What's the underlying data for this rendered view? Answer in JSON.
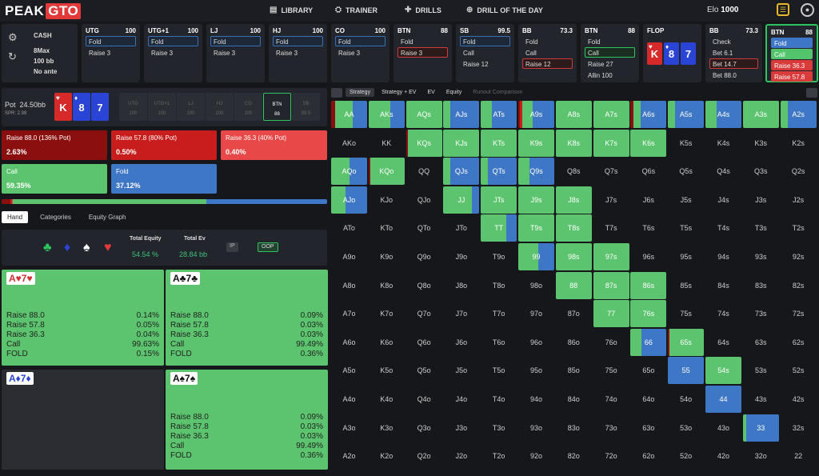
{
  "app": {
    "logo_a": "PEAK",
    "logo_b": "GTO"
  },
  "nav": [
    {
      "icon": "▤",
      "label": "LIBRARY"
    },
    {
      "icon": "⛭",
      "label": "TRAINER"
    },
    {
      "icon": "✚",
      "label": "DRILLS"
    },
    {
      "icon": "⊕",
      "label": "DRILL OF THE DAY"
    }
  ],
  "elo": {
    "label": "Elo",
    "value": "1000"
  },
  "game": {
    "type": "CASH",
    "size": "8Max",
    "stack": "100 bb",
    "ante": "No ante"
  },
  "seats": [
    {
      "pos": "UTG",
      "stack": "100",
      "actions": [
        {
          "l": "Fold",
          "s": "sel"
        },
        {
          "l": "Raise 3",
          "s": ""
        }
      ]
    },
    {
      "pos": "UTG+1",
      "stack": "100",
      "actions": [
        {
          "l": "Fold",
          "s": "sel"
        },
        {
          "l": "Raise 3",
          "s": ""
        }
      ]
    },
    {
      "pos": "LJ",
      "stack": "100",
      "actions": [
        {
          "l": "Fold",
          "s": "sel"
        },
        {
          "l": "Raise 3",
          "s": ""
        }
      ]
    },
    {
      "pos": "HJ",
      "stack": "100",
      "actions": [
        {
          "l": "Fold",
          "s": "sel"
        },
        {
          "l": "Raise 3",
          "s": ""
        }
      ]
    },
    {
      "pos": "CO",
      "stack": "100",
      "actions": [
        {
          "l": "Fold",
          "s": "sel"
        },
        {
          "l": "Raise 3",
          "s": ""
        }
      ]
    },
    {
      "pos": "BTN",
      "stack": "88",
      "actions": [
        {
          "l": "Fold",
          "s": ""
        },
        {
          "l": "Raise 3",
          "s": "selr"
        }
      ]
    },
    {
      "pos": "SB",
      "stack": "99.5",
      "actions": [
        {
          "l": "Fold",
          "s": "sel"
        },
        {
          "l": "Call",
          "s": ""
        },
        {
          "l": "Raise 12",
          "s": ""
        }
      ]
    },
    {
      "pos": "BB",
      "stack": "73.3",
      "actions": [
        {
          "l": "Fold",
          "s": ""
        },
        {
          "l": "Call",
          "s": ""
        },
        {
          "l": "Raise 12",
          "s": "selr"
        }
      ]
    },
    {
      "pos": "BTN",
      "stack": "88",
      "actions": [
        {
          "l": "Fold",
          "s": ""
        },
        {
          "l": "Call",
          "s": "selg"
        },
        {
          "l": "Raise 27",
          "s": ""
        },
        {
          "l": "Allin 100",
          "s": ""
        }
      ]
    },
    {
      "pos": "FLOP",
      "stack": "",
      "actions": []
    },
    {
      "pos": "BB",
      "stack": "73.3",
      "actions": [
        {
          "l": "Check",
          "s": ""
        },
        {
          "l": "Bet 6.1",
          "s": ""
        },
        {
          "l": "Bet 14.7",
          "s": "selr"
        },
        {
          "l": "Bet 88.0",
          "s": ""
        }
      ]
    },
    {
      "pos": "BTN",
      "stack": "88",
      "actions": [
        {
          "l": "Fold",
          "s": "fg"
        },
        {
          "l": "Call",
          "s": "fgg"
        },
        {
          "l": "Raise 36.3",
          "s": "fgr"
        },
        {
          "l": "Raise 57.8",
          "s": "fgr"
        }
      ]
    }
  ],
  "flop": [
    {
      "rank": "K",
      "suit": "♥",
      "color": "red"
    },
    {
      "rank": "8",
      "suit": "♦",
      "color": "blue"
    },
    {
      "rank": "7",
      "suit": "",
      "color": "blue"
    }
  ],
  "pot": {
    "label": "Pot",
    "value": "24.50bb",
    "spr": "SPR: 2.98"
  },
  "positions": [
    {
      "p": "UTG",
      "s": "100"
    },
    {
      "p": "UTG+1",
      "s": "100"
    },
    {
      "p": "LJ",
      "s": "100"
    },
    {
      "p": "HJ",
      "s": "100"
    },
    {
      "p": "CO",
      "s": "100"
    },
    {
      "p": "BTN",
      "s": "88"
    },
    {
      "p": "SB",
      "s": "99.5"
    }
  ],
  "actions": [
    {
      "label": "Raise 88.0 (136% Pot)",
      "pct": "2.63%",
      "color": "#8c0f0f"
    },
    {
      "label": "Raise 57.8 (80% Pot)",
      "pct": "0.50%",
      "color": "#c81d1d"
    },
    {
      "label": "Raise 36.3 (40% Pot)",
      "pct": "0.40%",
      "color": "#e84848"
    },
    {
      "label": "Call",
      "pct": "59.35%",
      "color": "#5cc46e"
    },
    {
      "label": "Fold",
      "pct": "37.12%",
      "color": "#3f77c7"
    }
  ],
  "freq": [
    2.63,
    0.5,
    0.4,
    59.35,
    37.12
  ],
  "tabs": [
    "Hand",
    "Categories",
    "Equity Graph"
  ],
  "equity": {
    "total_equity_label": "Total Equity",
    "total_equity": "54.54 %",
    "total_ev_label": "Total Ev",
    "total_ev": "28.84 bb",
    "ip": "IP",
    "oop": "OOP"
  },
  "combos": [
    {
      "rank1": "A",
      "s1": "♥",
      "rank2": "7",
      "s2": "♥",
      "rows": [
        [
          "Raise 88.0",
          "0.14%"
        ],
        [
          "Raise 57.8",
          "0.05%"
        ],
        [
          "Raise 36.3",
          "0.04%"
        ],
        [
          "Call",
          "99.63%"
        ],
        [
          "FOLD",
          "0.15%"
        ]
      ]
    },
    {
      "rank1": "A",
      "s1": "♣",
      "rank2": "7",
      "s2": "♣",
      "rows": [
        [
          "Raise 88.0",
          "0.09%"
        ],
        [
          "Raise 57.8",
          "0.03%"
        ],
        [
          "Raise 36.3",
          "0.03%"
        ],
        [
          "Call",
          "99.49%"
        ],
        [
          "FOLD",
          "0.36%"
        ]
      ]
    },
    {
      "rank1": "A",
      "s1": "♦",
      "rank2": "7",
      "s2": "♦",
      "rows": []
    },
    {
      "rank1": "A",
      "s1": "♠",
      "rank2": "7",
      "s2": "♠",
      "rows": [
        [
          "Raise 88.0",
          "0.09%"
        ],
        [
          "Raise 57.8",
          "0.03%"
        ],
        [
          "Raise 36.3",
          "0.03%"
        ],
        [
          "Call",
          "99.49%"
        ],
        [
          "FOLD",
          "0.36%"
        ]
      ]
    }
  ],
  "grid_tabs": [
    {
      "l": "Strategy",
      "c": "on"
    },
    {
      "l": "Strategy + EV",
      "c": ""
    },
    {
      "l": "EV",
      "c": ""
    },
    {
      "l": "Equity",
      "c": ""
    },
    {
      "l": "Runout Comparison",
      "c": "dim"
    }
  ],
  "ranks": [
    "A",
    "K",
    "Q",
    "J",
    "T",
    "9",
    "8",
    "7",
    "6",
    "5",
    "4",
    "3",
    "2"
  ],
  "hand_strategy": {
    "AA": [
      10,
      0,
      0,
      50,
      40
    ],
    "AKs": [
      0,
      0,
      0,
      60,
      40
    ],
    "AQs": [
      0,
      0,
      0,
      100,
      0
    ],
    "AJs": [
      0,
      0,
      0,
      20,
      80
    ],
    "ATs": [
      0,
      0,
      0,
      30,
      70
    ],
    "A9s": [
      5,
      5,
      0,
      30,
      60
    ],
    "A8s": [
      0,
      0,
      0,
      100,
      0
    ],
    "A7s": [
      0,
      0,
      0,
      100,
      0
    ],
    "A6s": [
      8,
      0,
      0,
      20,
      72
    ],
    "A5s": [
      0,
      0,
      0,
      20,
      80
    ],
    "A4s": [
      0,
      0,
      0,
      30,
      70
    ],
    "A3s": [
      0,
      0,
      0,
      100,
      0
    ],
    "A2s": [
      0,
      0,
      0,
      20,
      80
    ],
    "KQs": [
      5,
      0,
      0,
      95,
      0
    ],
    "KJs": [
      0,
      0,
      0,
      100,
      0
    ],
    "KTs": [
      0,
      0,
      0,
      100,
      0
    ],
    "K9s": [
      0,
      0,
      0,
      100,
      0
    ],
    "K8s": [
      0,
      0,
      0,
      100,
      0
    ],
    "K7s": [
      0,
      0,
      0,
      100,
      0
    ],
    "K6s": [
      0,
      0,
      0,
      100,
      0
    ],
    "AQo": [
      0,
      0,
      0,
      50,
      50
    ],
    "KQo": [
      4,
      0,
      0,
      96,
      0
    ],
    "QJs": [
      0,
      0,
      0,
      20,
      80
    ],
    "QTs": [
      0,
      0,
      0,
      20,
      80
    ],
    "Q9s": [
      0,
      0,
      0,
      30,
      70
    ],
    "AJo": [
      0,
      0,
      0,
      40,
      60
    ],
    "JJ": [
      0,
      0,
      0,
      80,
      20
    ],
    "JTs": [
      0,
      0,
      0,
      100,
      0
    ],
    "J9s": [
      0,
      0,
      0,
      100,
      0
    ],
    "J8s": [
      0,
      0,
      0,
      100,
      0
    ],
    "TT": [
      0,
      0,
      0,
      70,
      30
    ],
    "T9s": [
      0,
      0,
      0,
      100,
      0
    ],
    "T8s": [
      0,
      0,
      0,
      100,
      0
    ],
    "99": [
      0,
      0,
      0,
      55,
      45
    ],
    "98s": [
      0,
      0,
      0,
      100,
      0
    ],
    "97s": [
      0,
      0,
      0,
      100,
      0
    ],
    "88": [
      0,
      0,
      0,
      100,
      0
    ],
    "87s": [
      0,
      0,
      0,
      100,
      0
    ],
    "86s": [
      0,
      0,
      0,
      100,
      0
    ],
    "77": [
      0,
      0,
      0,
      100,
      0
    ],
    "76s": [
      0,
      0,
      0,
      100,
      0
    ],
    "66": [
      0,
      0,
      0,
      30,
      70
    ],
    "65s": [
      5,
      0,
      0,
      95,
      0
    ],
    "55": [
      0,
      0,
      0,
      0,
      100
    ],
    "54s": [
      0,
      0,
      0,
      100,
      0
    ],
    "44": [
      0,
      0,
      0,
      0,
      100
    ],
    "33": [
      0,
      0,
      0,
      10,
      90
    ]
  }
}
